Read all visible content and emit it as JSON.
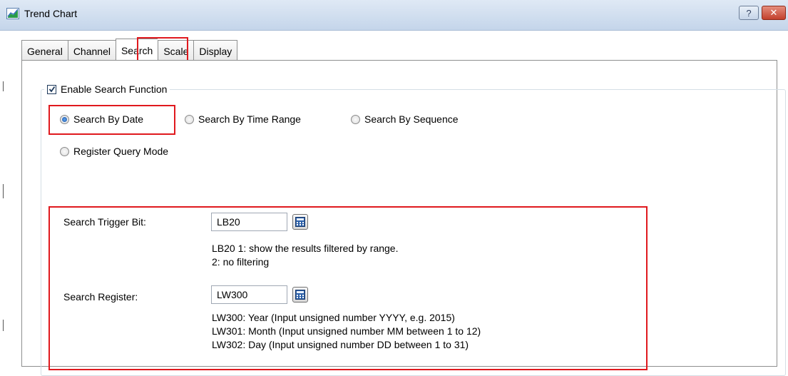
{
  "window": {
    "title": "Trend Chart",
    "help_glyph": "?",
    "close_glyph": "✕"
  },
  "tabs": [
    {
      "label": "General"
    },
    {
      "label": "Channel"
    },
    {
      "label": "Search",
      "active": true
    },
    {
      "label": "Scale"
    },
    {
      "label": "Display"
    }
  ],
  "search": {
    "enable_label": "Enable Search Function",
    "enable_checked": true,
    "modes": [
      {
        "label": "Search By Date",
        "checked": true
      },
      {
        "label": "Search By Time Range",
        "checked": false
      },
      {
        "label": "Search By Sequence",
        "checked": false
      },
      {
        "label": "Register Query Mode",
        "checked": false
      }
    ],
    "trigger": {
      "label": "Search Trigger Bit:",
      "value": "LB20",
      "notes": [
        "LB20 1: show the results filtered by range.",
        "2: no filtering"
      ]
    },
    "register": {
      "label": "Search Register:",
      "value": "LW300",
      "notes": [
        "LW300: Year (Input unsigned number YYYY, e.g. 2015)",
        "LW301: Month (Input unsigned number MM between 1 to 12)",
        "LW302: Day (Input unsigned number DD between 1 to 31)"
      ]
    }
  },
  "icons": {
    "app": "trend-chart-app-icon",
    "calculator": "calculator-icon",
    "check": "checkmark-icon"
  },
  "colors": {
    "highlight": "#e0191e",
    "titlebar": "#c4d5ea",
    "close": "#c2402c"
  }
}
